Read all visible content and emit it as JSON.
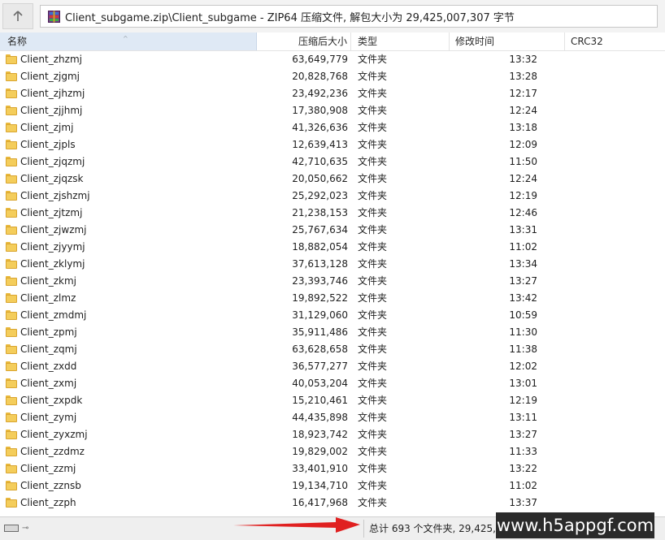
{
  "path_bar": {
    "up_icon": "arrow-up-icon",
    "archive_icon": "winrar-archive-icon",
    "path_text": "Client_subgame.zip\\Client_subgame - ZIP64 压缩文件, 解包大小为 29,425,007,307 字节"
  },
  "columns": {
    "name": "名称",
    "packed_size": "压缩后大小",
    "type": "类型",
    "modified": "修改时间",
    "crc": "CRC32",
    "sort_indicator": "^"
  },
  "files": [
    {
      "name": "Client_zhzmj",
      "size": "63,649,779",
      "type": "文件夹",
      "modified": "13:32"
    },
    {
      "name": "Client_zjgmj",
      "size": "20,828,768",
      "type": "文件夹",
      "modified": "13:28"
    },
    {
      "name": "Client_zjhzmj",
      "size": "23,492,236",
      "type": "文件夹",
      "modified": "12:17"
    },
    {
      "name": "Client_zjjhmj",
      "size": "17,380,908",
      "type": "文件夹",
      "modified": "12:24"
    },
    {
      "name": "Client_zjmj",
      "size": "41,326,636",
      "type": "文件夹",
      "modified": "13:18"
    },
    {
      "name": "Client_zjpls",
      "size": "12,639,413",
      "type": "文件夹",
      "modified": "12:09"
    },
    {
      "name": "Client_zjqzmj",
      "size": "42,710,635",
      "type": "文件夹",
      "modified": "11:50"
    },
    {
      "name": "Client_zjqzsk",
      "size": "20,050,662",
      "type": "文件夹",
      "modified": "12:24"
    },
    {
      "name": "Client_zjshzmj",
      "size": "25,292,023",
      "type": "文件夹",
      "modified": "12:19"
    },
    {
      "name": "Client_zjtzmj",
      "size": "21,238,153",
      "type": "文件夹",
      "modified": "12:46"
    },
    {
      "name": "Client_zjwzmj",
      "size": "25,767,634",
      "type": "文件夹",
      "modified": "13:31"
    },
    {
      "name": "Client_zjyymj",
      "size": "18,882,054",
      "type": "文件夹",
      "modified": "11:02"
    },
    {
      "name": "Client_zklymj",
      "size": "37,613,128",
      "type": "文件夹",
      "modified": "13:34"
    },
    {
      "name": "Client_zkmj",
      "size": "23,393,746",
      "type": "文件夹",
      "modified": "13:27"
    },
    {
      "name": "Client_zlmz",
      "size": "19,892,522",
      "type": "文件夹",
      "modified": "13:42"
    },
    {
      "name": "Client_zmdmj",
      "size": "31,129,060",
      "type": "文件夹",
      "modified": "10:59"
    },
    {
      "name": "Client_zpmj",
      "size": "35,911,486",
      "type": "文件夹",
      "modified": "11:30"
    },
    {
      "name": "Client_zqmj",
      "size": "63,628,658",
      "type": "文件夹",
      "modified": "11:38"
    },
    {
      "name": "Client_zxdd",
      "size": "36,577,277",
      "type": "文件夹",
      "modified": "12:02"
    },
    {
      "name": "Client_zxmj",
      "size": "40,053,204",
      "type": "文件夹",
      "modified": "13:01"
    },
    {
      "name": "Client_zxpdk",
      "size": "15,210,461",
      "type": "文件夹",
      "modified": "12:19"
    },
    {
      "name": "Client_zymj",
      "size": "44,435,898",
      "type": "文件夹",
      "modified": "13:11"
    },
    {
      "name": "Client_zyxzmj",
      "size": "18,923,742",
      "type": "文件夹",
      "modified": "13:27"
    },
    {
      "name": "Client_zzdmz",
      "size": "19,829,002",
      "type": "文件夹",
      "modified": "11:33"
    },
    {
      "name": "Client_zzmj",
      "size": "33,401,910",
      "type": "文件夹",
      "modified": "13:22"
    },
    {
      "name": "Client_zznsb",
      "size": "19,134,710",
      "type": "文件夹",
      "modified": "11:02"
    },
    {
      "name": "Client_zzph",
      "size": "16,417,968",
      "type": "文件夹",
      "modified": "13:37"
    }
  ],
  "status_bar": {
    "drive_icon": "drive-icon",
    "key_icon": "key-icon",
    "text": "总计 693 个文件夹, 29,425,0"
  },
  "annotation": {
    "arrow_color": "#e02020",
    "arrow_icon": "red-arrow-icon"
  },
  "watermark": {
    "text": "www.h5appgf.com"
  }
}
